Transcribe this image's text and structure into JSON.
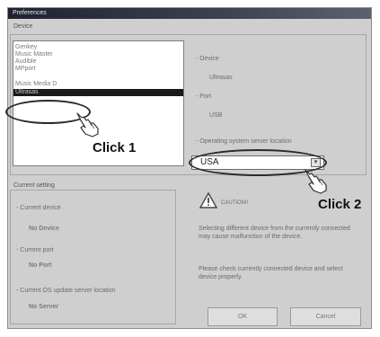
{
  "window": {
    "title": "Preferences"
  },
  "device_group": {
    "label": "Device",
    "list_items": [
      {
        "label": "Genkey"
      },
      {
        "label": "Music Master"
      },
      {
        "label": "Audible"
      },
      {
        "label": "MPport"
      },
      {
        "label": "Music Media D"
      },
      {
        "label": "Ultrasas",
        "selected": true
      }
    ],
    "device_label": "- Device",
    "device_value": "Ultrasas",
    "port_label": "- Port",
    "port_value": "USB",
    "server_label": "- Operating system server location",
    "server_select": {
      "value": "USA",
      "arrow": "chevron-down-icon"
    }
  },
  "current_group": {
    "label": "Current setting",
    "device_label": "- Current device",
    "device_value": "No Device",
    "port_label": "- Current port",
    "port_value": "No Port",
    "server_label": "- Current OS update server location",
    "server_value": "No Server"
  },
  "caution": {
    "icon": "warning-icon",
    "title": "CAUTION!!",
    "text1": "Selecting different device from the currently connected may cause malfunction of the device.",
    "text2": "Please check currently connected device and select device properly."
  },
  "buttons": {
    "ok": "OK",
    "cancel": "Cancel"
  },
  "annotations": {
    "click1": "Click 1",
    "click2": "Click 2"
  }
}
